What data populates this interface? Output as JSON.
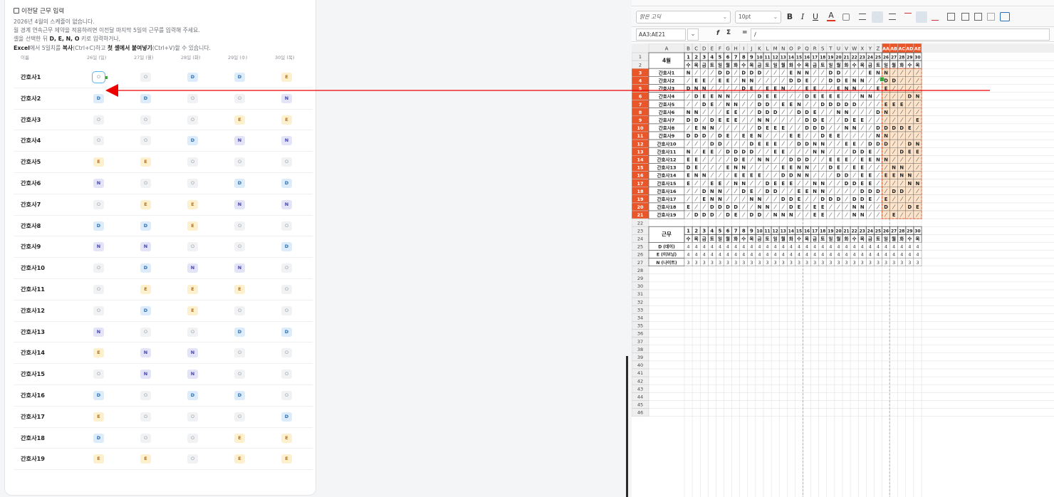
{
  "left": {
    "title": "이전달 근무 입력",
    "desc": [
      "2026년 4월의 스케줄이 없습니다.",
      "월 경계 연속근무 제약을 적용하려면 이전달 마지막 5일의 근무를 입력해 주세요.",
      "셀을 선택한 뒤 D, E, N, O 키로 입력하거나,"
    ],
    "desc4_excel": "Excel",
    "desc4_a": "에서 5일치를 ",
    "desc4_copy": "복사",
    "desc4_b": "(Ctrl+C)하고 ",
    "desc4_paste": "첫 셀에서 붙여넣기",
    "desc4_c": "(Ctrl+V)할 수 있습니다.",
    "col_name": "이름",
    "dates": [
      "26일 (일)",
      "27일 (월)",
      "28일 (화)",
      "29일 (수)",
      "30일 (목)"
    ],
    "rows": [
      {
        "name": "간호사1",
        "shifts": [
          "O",
          "O",
          "D",
          "D",
          "E"
        ]
      },
      {
        "name": "간호사2",
        "shifts": [
          "D",
          "D",
          "O",
          "O",
          "N"
        ]
      },
      {
        "name": "간호사3",
        "shifts": [
          "O",
          "O",
          "O",
          "E",
          "E"
        ]
      },
      {
        "name": "간호사4",
        "shifts": [
          "O",
          "O",
          "D",
          "N",
          "N"
        ]
      },
      {
        "name": "간호사5",
        "shifts": [
          "E",
          "E",
          "O",
          "O",
          "O"
        ]
      },
      {
        "name": "간호사6",
        "shifts": [
          "N",
          "O",
          "O",
          "D",
          "D"
        ]
      },
      {
        "name": "간호사7",
        "shifts": [
          "O",
          "E",
          "E",
          "N",
          "N"
        ]
      },
      {
        "name": "간호사8",
        "shifts": [
          "D",
          "D",
          "E",
          "O",
          "O"
        ]
      },
      {
        "name": "간호사9",
        "shifts": [
          "N",
          "N",
          "O",
          "O",
          "D"
        ]
      },
      {
        "name": "간호사10",
        "shifts": [
          "O",
          "D",
          "N",
          "N",
          "O"
        ]
      },
      {
        "name": "간호사11",
        "shifts": [
          "O",
          "E",
          "E",
          "E",
          "O"
        ]
      },
      {
        "name": "간호사12",
        "shifts": [
          "O",
          "D",
          "E",
          "O",
          "O"
        ]
      },
      {
        "name": "간호사13",
        "shifts": [
          "N",
          "O",
          "O",
          "D",
          "D"
        ]
      },
      {
        "name": "간호사14",
        "shifts": [
          "E",
          "N",
          "N",
          "O",
          "O"
        ]
      },
      {
        "name": "간호사15",
        "shifts": [
          "O",
          "N",
          "N",
          "O",
          "O"
        ]
      },
      {
        "name": "간호사16",
        "shifts": [
          "D",
          "O",
          "D",
          "D",
          "O"
        ]
      },
      {
        "name": "간호사17",
        "shifts": [
          "E",
          "O",
          "O",
          "O",
          "D"
        ]
      },
      {
        "name": "간호사18",
        "shifts": [
          "D",
          "O",
          "O",
          "E",
          "E"
        ]
      },
      {
        "name": "간호사19",
        "shifts": [
          "E",
          "E",
          "O",
          "E",
          "E"
        ]
      }
    ],
    "selected": {
      "row": 0,
      "col": 0
    }
  },
  "right": {
    "font_name": "맑은 고딕",
    "font_size": "10pt",
    "name_box": "AA3:AE21",
    "formula": "/",
    "fx": "f",
    "sigma": "Σ",
    "eq": "=",
    "toolbar_glyphs": [
      "B",
      "I",
      "U",
      "A"
    ],
    "col_letters": [
      "A",
      "B",
      "C",
      "D",
      "E",
      "F",
      "G",
      "H",
      "I",
      "J",
      "K",
      "L",
      "M",
      "N",
      "O",
      "P",
      "Q",
      "R",
      "S",
      "T",
      "U",
      "V",
      "W",
      "X",
      "Y",
      "Z",
      "AA",
      "AB",
      "AC",
      "AD",
      "AE"
    ],
    "month_label": "4월",
    "day_nums": [
      "1",
      "2",
      "3",
      "4",
      "5",
      "6",
      "7",
      "8",
      "9",
      "10",
      "11",
      "12",
      "13",
      "14",
      "15",
      "16",
      "17",
      "18",
      "19",
      "20",
      "21",
      "22",
      "23",
      "24",
      "25",
      "26",
      "27",
      "28",
      "29",
      "30"
    ],
    "weekdays": [
      "수",
      "목",
      "금",
      "토",
      "일",
      "월",
      "화",
      "수",
      "목",
      "금",
      "토",
      "일",
      "월",
      "화",
      "수",
      "목",
      "금",
      "토",
      "일",
      "월",
      "화",
      "수",
      "목",
      "금",
      "토",
      "일",
      "월",
      "화",
      "수",
      "목"
    ],
    "nurses": [
      {
        "name": "간호사1",
        "cells": "N   DD DDD   ENN  DD   ENN    DDE"
      },
      {
        "name": "간호사2",
        "cells": " EE EE NN    DDE  DDENN  DD    N"
      },
      {
        "name": "간호사3",
        "cells": "DNN    DE EEN  EE  ENN  EE    EE"
      },
      {
        "name": "간호사4",
        "cells": " DEENN   DEE   DEEEE  NN    DNN"
      },
      {
        "name": "간호사5",
        "cells": "  DE NN  DD EEN  DDDDD   EEE"
      },
      {
        "name": "간호사6",
        "cells": "NN   EE  DDD  DDE  NN   DN    DD"
      },
      {
        "name": "간호사7",
        "cells": "DD DEEE  NN    DDE  DEE      EENN"
      },
      {
        "name": "간호사8",
        "cells": " ENN     DEEE  DDD  NN  DDDDE"
      },
      {
        "name": "간호사9",
        "cells": "DDD DE EEN   EE  DEE    NN    D"
      },
      {
        "name": "간호사10",
        "cells": "   DD   DEEE  DDNN  EE DDD  DNN"
      },
      {
        "name": "간호사11",
        "cells": "N EE DDDD  EE   NN   DDE   DEE"
      },
      {
        "name": "간호사12",
        "cells": "EE    DE NN  DDD  EEE EENN    DE"
      },
      {
        "name": "간호사13",
        "cells": "DE   ENN    EENN  DE EE   NN    DD"
      },
      {
        "name": "간호사14",
        "cells": "ENN   EEEE  DDNN   DD EE EENN"
      },
      {
        "name": "간호사15",
        "cells": "E  EE NN  DEEE  NN  DDEE    NN"
      },
      {
        "name": "간호사16",
        "cells": "  DNN  DE DD  EENN    DDD DD"
      },
      {
        "name": "간호사17",
        "cells": "  ENN   NN  DDE  DDD DDE E     D"
      },
      {
        "name": "간호사18",
        "cells": "E  DDDD  NN  DE EE   NN  D  DEE"
      },
      {
        "name": "간호사19",
        "cells": " DDD DE DD NNN  EE   NN   E    EE"
      }
    ],
    "summary_label": "근무",
    "summary": [
      {
        "label": "D (데이)",
        "value": "4"
      },
      {
        "label": "E (이브닝)",
        "value": "4"
      },
      {
        "label": "N (나이트)",
        "value": "3"
      }
    ],
    "row_count_end": "46"
  }
}
